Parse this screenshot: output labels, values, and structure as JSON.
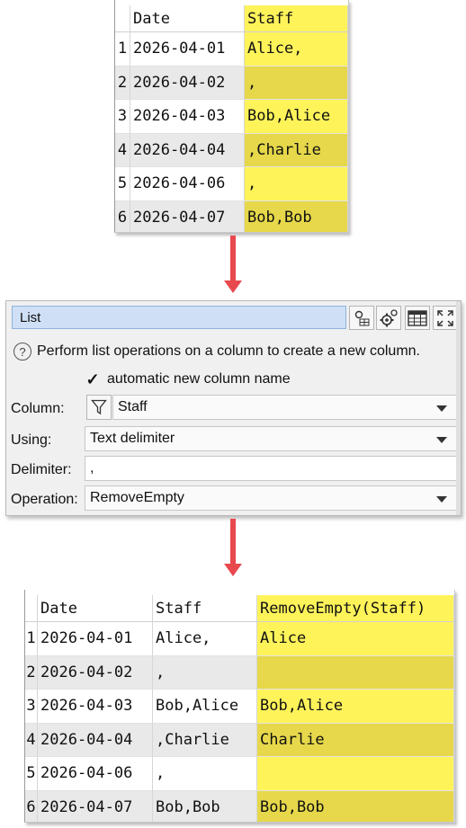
{
  "input_table": {
    "columns": [
      "Date",
      "Staff"
    ],
    "rows": [
      {
        "n": "1",
        "date": "2026-04-01",
        "staff": "Alice,"
      },
      {
        "n": "2",
        "date": "2026-04-02",
        "staff": ","
      },
      {
        "n": "3",
        "date": "2026-04-03",
        "staff": "Bob,Alice"
      },
      {
        "n": "4",
        "date": "2026-04-04",
        "staff": ",Charlie"
      },
      {
        "n": "5",
        "date": "2026-04-06",
        "staff": ","
      },
      {
        "n": "6",
        "date": "2026-04-07",
        "staff": "Bob,Bob"
      }
    ]
  },
  "panel": {
    "title": "List",
    "description": "Perform list operations on a column to create a new column.",
    "auto_name_label": "automatic new column name",
    "auto_name_checked": true,
    "column_label": "Column:",
    "column_value": "Staff",
    "using_label": "Using:",
    "using_value": "Text delimiter",
    "delimiter_label": "Delimiter:",
    "delimiter_value": ",",
    "operation_label": "Operation:",
    "operation_value": "RemoveEmpty"
  },
  "output_table": {
    "columns": [
      "Date",
      "Staff",
      "RemoveEmpty(Staff)"
    ],
    "rows": [
      {
        "n": "1",
        "date": "2026-04-01",
        "staff": "Alice,",
        "result": "Alice"
      },
      {
        "n": "2",
        "date": "2026-04-02",
        "staff": ",",
        "result": ""
      },
      {
        "n": "3",
        "date": "2026-04-03",
        "staff": "Bob,Alice",
        "result": "Bob,Alice"
      },
      {
        "n": "4",
        "date": "2026-04-04",
        "staff": ",Charlie",
        "result": "Charlie"
      },
      {
        "n": "5",
        "date": "2026-04-06",
        "staff": ",",
        "result": ""
      },
      {
        "n": "6",
        "date": "2026-04-07",
        "staff": "Bob,Bob",
        "result": "Bob,Bob"
      }
    ]
  },
  "colors": {
    "highlight": "#fff35a",
    "highlight_alt": "#e6d84a",
    "arrow": "#e8494e",
    "title_bg": "#cfe0f6"
  }
}
